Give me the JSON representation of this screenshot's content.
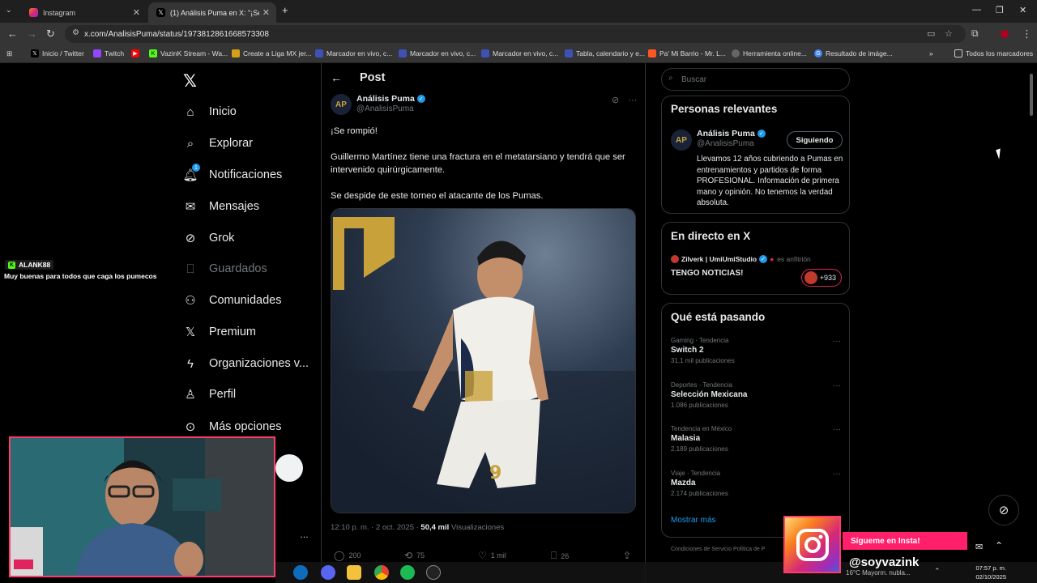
{
  "browser": {
    "tabs": [
      {
        "label": "Instagram",
        "icon": "instagram-icon"
      },
      {
        "label": "(1) Análisis Puma en X: \"¡Se rom",
        "icon": "x-icon"
      }
    ],
    "url": "x.com/AnalisisPuma/status/1973812861668573308",
    "bookmarks": [
      {
        "label": "Inicio / Twitter",
        "icon": "x-icon",
        "color": "#000000"
      },
      {
        "label": "Twitch",
        "icon": "twitch-icon",
        "color": "#9146ff"
      },
      {
        "label": "",
        "icon": "youtube-icon",
        "color": "#ff0000"
      },
      {
        "label": "VazinK Stream - Wa...",
        "icon": "kick-icon",
        "color": "#53fc18"
      },
      {
        "label": "Create a Liga MX jer...",
        "icon": "page-icon",
        "color": "#d4a017"
      },
      {
        "label": "Marcador en vivo, c...",
        "icon": "score-icon",
        "color": "#3f51b5"
      },
      {
        "label": "Marcador en vivo, c...",
        "icon": "score-icon",
        "color": "#3f51b5"
      },
      {
        "label": "Marcador en vivo, c...",
        "icon": "score-icon",
        "color": "#3f51b5"
      },
      {
        "label": "Tabla, calendario y e...",
        "icon": "score-icon",
        "color": "#3f51b5"
      },
      {
        "label": "Pa' Mi Barrio - Mr. L...",
        "icon": "page-icon",
        "color": "#ff5722"
      },
      {
        "label": "Herramienta online...",
        "icon": "globe-icon",
        "color": "#666666"
      },
      {
        "label": "Resultado de imáge...",
        "icon": "google-icon",
        "color": "#4285f4"
      }
    ],
    "all_bookmarks": "Todos los marcadores"
  },
  "nav": {
    "items": [
      {
        "label": "Inicio",
        "icon": "home-icon"
      },
      {
        "label": "Explorar",
        "icon": "search-icon"
      },
      {
        "label": "Notificaciones",
        "icon": "bell-icon",
        "badge": "1"
      },
      {
        "label": "Mensajes",
        "icon": "mail-icon"
      },
      {
        "label": "Grok",
        "icon": "grok-icon"
      },
      {
        "label": "Guardados",
        "icon": "bookmark-icon"
      },
      {
        "label": "Comunidades",
        "icon": "communities-icon"
      },
      {
        "label": "Premium",
        "icon": "x-premium-icon"
      },
      {
        "label": "Organizaciones v...",
        "icon": "lightning-icon"
      },
      {
        "label": "Perfil",
        "icon": "person-icon"
      },
      {
        "label": "Más opciones",
        "icon": "more-icon"
      }
    ]
  },
  "post": {
    "header": "Post",
    "author_name": "Análisis Puma",
    "author_handle": "@AnalisisPuma",
    "text_1": "¡Se rompió!",
    "text_2": "Guillermo Martínez tiene una fractura en el metatarsiano y tendrá que ser intervenido quirúrgicamente.",
    "text_3": "Se despide de este torneo el atacante de los Pumas.",
    "timestamp": "12:10 p. m. · 2 oct. 2025 · ",
    "views_count": "50,4 mil",
    "views_label": " Visualizaciones",
    "actions": {
      "replies": "200",
      "reposts": "75",
      "likes": "1 mil",
      "bookmarks": "26"
    }
  },
  "sidebar": {
    "search_placeholder": "Buscar",
    "relevant_title": "Personas relevantes",
    "relevant_name": "Análisis Puma",
    "relevant_handle": "@AnalisisPuma",
    "follow_label": "Siguiendo",
    "bio": "Llevamos 12 años cubriendo a Pumas en entrenamientos y partidos de forma PROFESIONAL. Información de primera mano y opinión. No tenemos la verdad absoluta.",
    "live_title": "En directo en X",
    "live_host": "Zilverk | UmiUmiStudio",
    "live_host_role": "es anfitrión",
    "live_text": "TENGO NOTICIAS!",
    "live_count": "+933",
    "trending_title": "Qué está pasando",
    "trends": [
      {
        "category": "Gaming · Tendencia",
        "name": "Switch 2",
        "count": "31,1 mil publicaciones"
      },
      {
        "category": "Deportes · Tendencia",
        "name": "Selección Mexicana",
        "count": "1.086 publicaciones"
      },
      {
        "category": "Tendencia en México",
        "name": "Malasia",
        "count": "2.189 publicaciones"
      },
      {
        "category": "Viaje · Tendencia",
        "name": "Mazda",
        "count": "2.174 publicaciones"
      }
    ],
    "show_more": "Mostrar más",
    "footer": "Condiciones de Servicio     Política de P"
  },
  "stream": {
    "chat_user": "ALANK88",
    "chat_msg": "Muy buenas para todos que caga los pumecos",
    "insta_banner": "Sígueme en Insta!",
    "insta_handle": "@soyvazink"
  },
  "taskbar": {
    "weather": "16°C  Mayorm. nubla...",
    "time": "07:57 p. m.",
    "date": "02/10/2025"
  },
  "colors": {
    "accent": "#1d9bf0",
    "background": "#000000",
    "overlay": "#ff3b6b"
  }
}
